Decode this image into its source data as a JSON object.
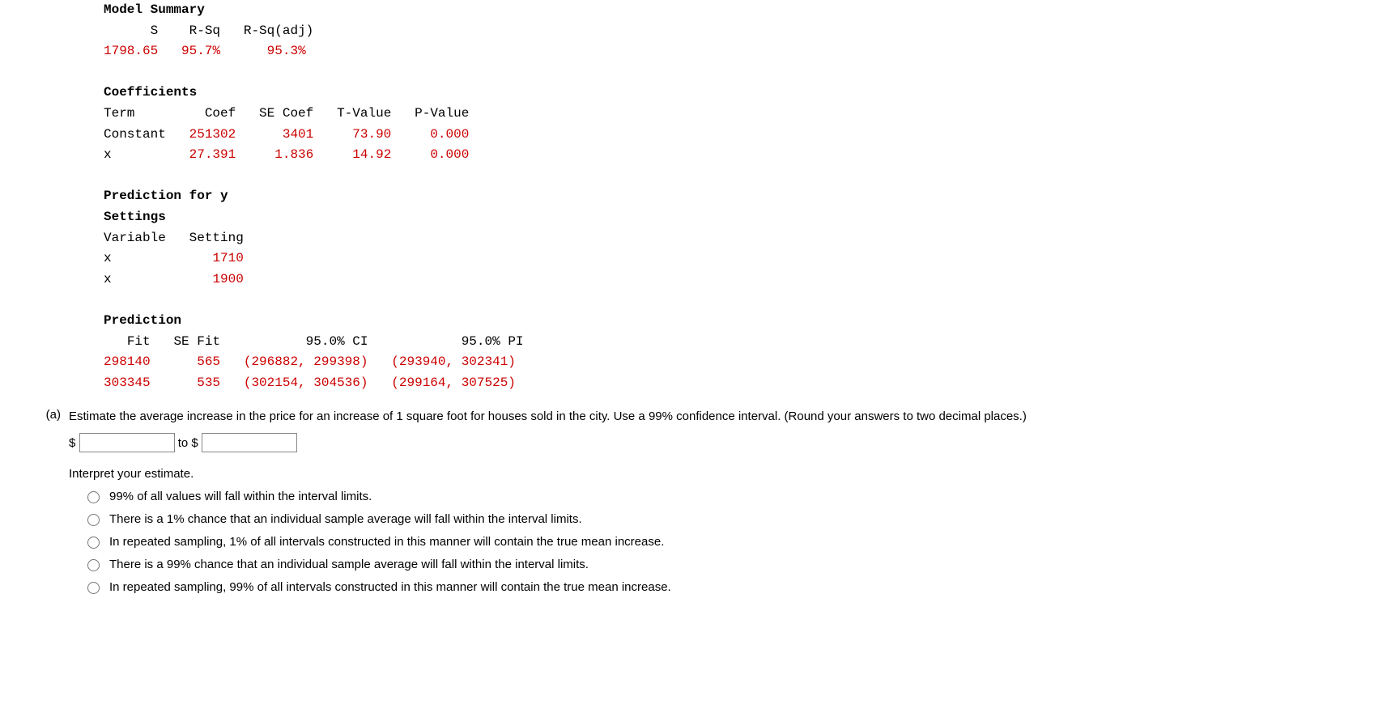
{
  "model_summary": {
    "title": "Model Summary",
    "headers": {
      "s": "S",
      "rsq": "R-Sq",
      "rsqadj": "R-Sq(adj)"
    },
    "values": {
      "s": "1798.65",
      "rsq": "95.7%",
      "rsqadj": "95.3%"
    }
  },
  "coefficients": {
    "title": "Coefficients",
    "headers": {
      "term": "Term",
      "coef": "Coef",
      "secoef": "SE Coef",
      "tvalue": "T-Value",
      "pvalue": "P-Value"
    },
    "rows": [
      {
        "term": "Constant",
        "coef": "251302",
        "secoef": "3401",
        "tvalue": "73.90",
        "pvalue": "0.000"
      },
      {
        "term": "x",
        "coef": "27.391",
        "secoef": "1.836",
        "tvalue": "14.92",
        "pvalue": "0.000"
      }
    ]
  },
  "prediction_for_y": {
    "title": "Prediction for y",
    "settings_title": "Settings",
    "headers": {
      "variable": "Variable",
      "setting": "Setting"
    },
    "rows": [
      {
        "variable": "x",
        "setting": "1710"
      },
      {
        "variable": "x",
        "setting": "1900"
      }
    ]
  },
  "prediction": {
    "title": "Prediction",
    "headers": {
      "fit": "Fit",
      "sefit": "SE Fit",
      "ci": "95.0% CI",
      "pi": "95.0% PI"
    },
    "rows": [
      {
        "fit": "298140",
        "sefit": "565",
        "ci": "(296882, 299398)",
        "pi": "(293940, 302341)"
      },
      {
        "fit": "303345",
        "sefit": "535",
        "ci": "(302154, 304536)",
        "pi": "(299164, 307525)"
      }
    ]
  },
  "question": {
    "label": "(a)",
    "text": "Estimate the average increase in the price for an increase of 1 square foot for houses sold in the city. Use a 99% confidence interval. (Round your answers to two decimal places.)",
    "dollar1": "$",
    "to": " to $",
    "interpret_label": "Interpret your estimate.",
    "options": [
      "99% of all values will fall within the interval limits.",
      "There is a 1% chance that an individual sample average will fall within the interval limits.",
      "In repeated sampling, 1% of all intervals constructed in this manner will contain the true mean increase.",
      "There is a 99% chance that an individual sample average will fall within the interval limits.",
      "In repeated sampling, 99% of all intervals constructed in this manner will contain the true mean increase."
    ]
  }
}
